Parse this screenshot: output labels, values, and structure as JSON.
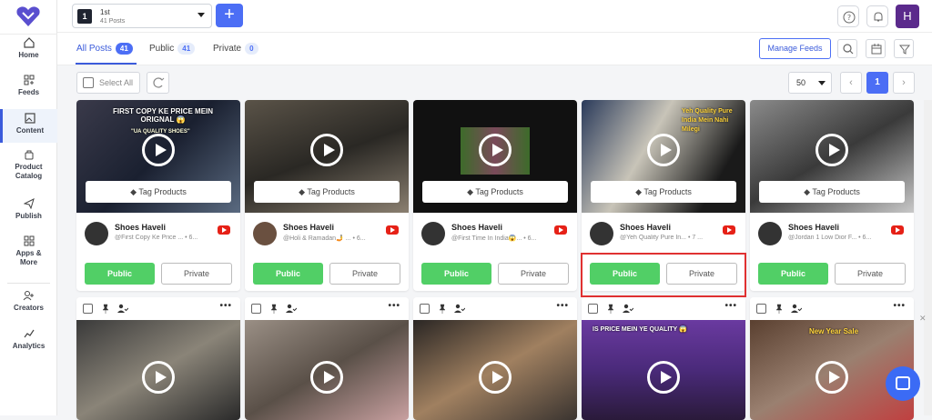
{
  "sidebar": {
    "items": [
      {
        "label": "Home",
        "icon": "home-icon"
      },
      {
        "label": "Feeds",
        "icon": "feeds-icon"
      },
      {
        "label": "Content",
        "icon": "content-icon",
        "active": true
      },
      {
        "label": "Product Catalog",
        "icon": "bag-icon"
      },
      {
        "label": "Publish",
        "icon": "send-icon"
      },
      {
        "label": "Apps & More",
        "icon": "apps-icon"
      },
      {
        "label": "Creators",
        "icon": "creators-icon"
      },
      {
        "label": "Analytics",
        "icon": "analytics-icon"
      }
    ]
  },
  "topbar": {
    "account_number": "1",
    "account_name": "1st",
    "account_posts": "41 Posts",
    "add_label": "+",
    "avatar_letter": "H"
  },
  "tabs": {
    "items": [
      {
        "label": "All Posts",
        "count": "41"
      },
      {
        "label": "Public",
        "count": "41"
      },
      {
        "label": "Private",
        "count": "0"
      }
    ],
    "manage_feeds": "Manage Feeds"
  },
  "toolbar": {
    "select_all": "Select All",
    "per_page": "50",
    "current_page": "1"
  },
  "cards_row1": [
    {
      "name": "Shoes Haveli",
      "caption": "@First Copy Ke Price ... • 6...",
      "overlay": "FIRST COPY KE PRICE MEIN ORIGNAL 😱",
      "overlay2": "\"UA QUALITY SHOES\""
    },
    {
      "name": "Shoes Haveli",
      "caption": "@Holi & Ramadan🤳 ... • 6...",
      "overlay": "",
      "overlay2": ""
    },
    {
      "name": "Shoes Haveli",
      "caption": "@First Time In India😱... • 6...",
      "overlay": "",
      "overlay2": ""
    },
    {
      "name": "Shoes Haveli",
      "caption": "@Yeh Quality Pure In... • 7 ...",
      "overlay": "Yeh Quality Pure India Mein Nahi Milegi",
      "overlay2": ""
    },
    {
      "name": "Shoes Haveli",
      "caption": "@Jordan 1 Low Dior F... • 6...",
      "overlay": "",
      "overlay2": ""
    }
  ],
  "card_labels": {
    "tag_products": "Tag Products",
    "public": "Public",
    "private": "Private"
  },
  "cards_row2": [
    {
      "overlay": ""
    },
    {
      "overlay": ""
    },
    {
      "overlay": ""
    },
    {
      "overlay": "IS PRICE MEIN YE QUALITY 😱"
    },
    {
      "overlay": "New Year Sale"
    }
  ],
  "colors": {
    "accent": "#4c6ef5",
    "public_green": "#51cf66",
    "highlight_red": "#e03131"
  }
}
